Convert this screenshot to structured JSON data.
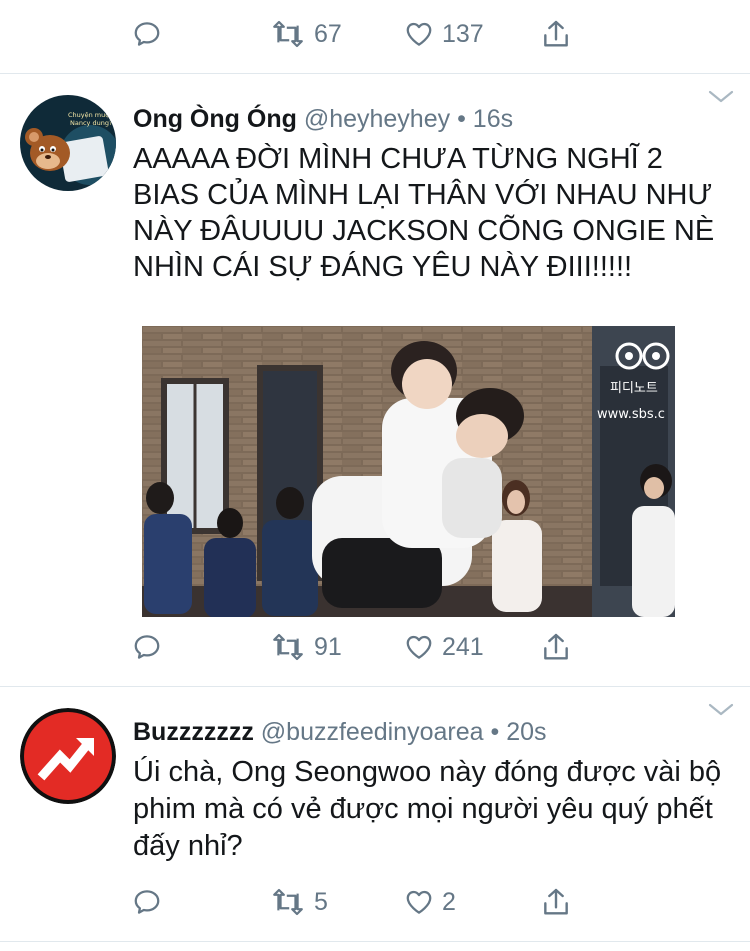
{
  "top_actions": {
    "retweets": "67",
    "likes": "137"
  },
  "tweets": [
    {
      "name": "Ong Òng Óng",
      "handle": "@heyheyhey",
      "time": "16s",
      "text": "AAAAA ĐỜI MÌNH CHƯA TỪNG NGHĨ 2 BIAS CỦA MÌNH LẠI THÂN VỚI NHAU NHƯ NÀY ĐÂUUUU JACKSON CÕNG ONGIE NÈ NHÌN CÁI SỰ ĐÁNG YÊU NÀY ĐIII!!!!!",
      "avatar_caption": "Chuyện muộn?! Nancy dung?",
      "photo_watermark": "피디노트",
      "photo_url_mark": "www.sbs.c",
      "retweets": "91",
      "likes": "241"
    },
    {
      "name": "Buzzzzzzz",
      "handle": "@buzzfeedinyoarea",
      "time": "20s",
      "text": "Úi chà, Ong Seongwoo này đóng được vài bộ phim mà có vẻ được mọi người yêu quý phết đấy nhỉ?",
      "retweets": "5",
      "likes": "2"
    }
  ],
  "colors": {
    "icon_gray": "#657786",
    "divider": "#e1e8ed",
    "buzzfeed_red": "#e32b25"
  }
}
